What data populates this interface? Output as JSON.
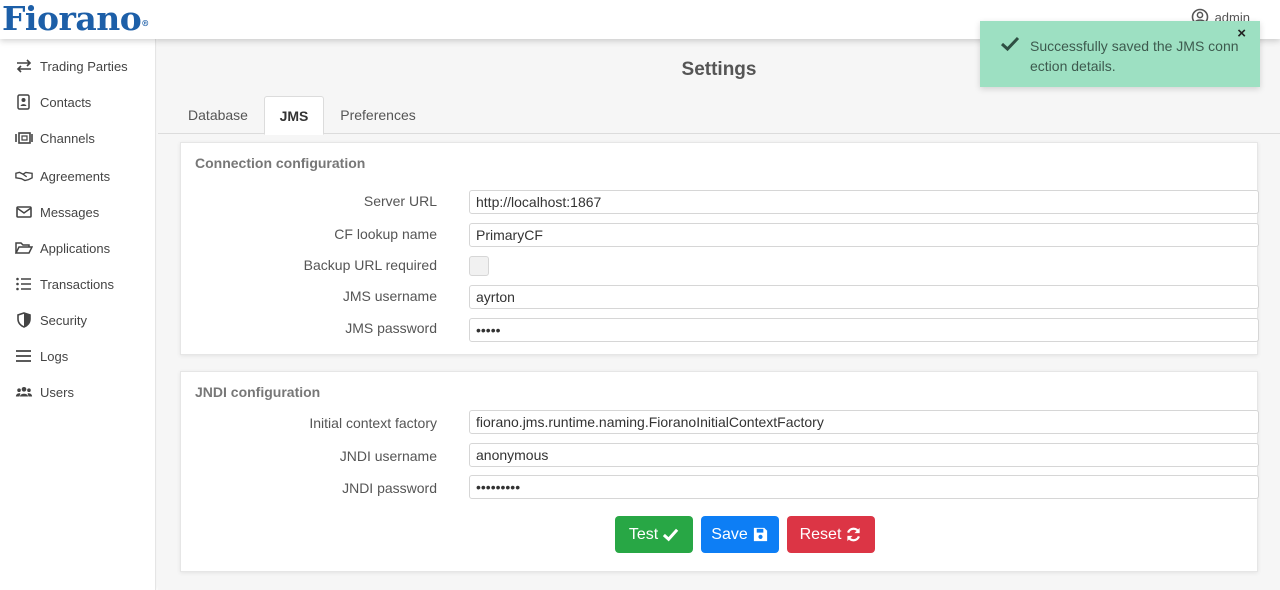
{
  "brand": {
    "logo_text": "Fiorano",
    "reg_mark": "®"
  },
  "header": {
    "username": "admin",
    "user_icon": "user-circle-icon"
  },
  "sidebar": {
    "items": [
      {
        "label": "Trading Parties",
        "icon": "arrows-exchange-icon"
      },
      {
        "label": "Contacts",
        "icon": "address-card-icon"
      },
      {
        "label": "Channels",
        "icon": "channel-icon"
      },
      {
        "label": "Agreements",
        "icon": "handshake-icon"
      },
      {
        "label": "Messages",
        "icon": "envelope-icon"
      },
      {
        "label": "Applications",
        "icon": "folder-open-icon"
      },
      {
        "label": "Transactions",
        "icon": "list-icon"
      },
      {
        "label": "Security",
        "icon": "shield-icon"
      },
      {
        "label": "Logs",
        "icon": "bars-icon"
      },
      {
        "label": "Users",
        "icon": "users-icon"
      }
    ]
  },
  "page": {
    "title": "Settings"
  },
  "tabs": [
    {
      "label": "Database",
      "active": false
    },
    {
      "label": "JMS",
      "active": true
    },
    {
      "label": "Preferences",
      "active": false
    }
  ],
  "connection": {
    "title": "Connection configuration",
    "server_url_label": "Server URL",
    "server_url_value": "http://localhost:1867",
    "cf_lookup_label": "CF lookup name",
    "cf_lookup_value": "PrimaryCF",
    "backup_url_label": "Backup URL required",
    "backup_url_checked": false,
    "jms_username_label": "JMS username",
    "jms_username_value": "ayrton",
    "jms_password_label": "JMS password",
    "jms_password_value": "•••••"
  },
  "jndi": {
    "title": "JNDI configuration",
    "icf_label": "Initial context factory",
    "icf_value": "fiorano.jms.runtime.naming.FioranoInitialContextFactory",
    "username_label": "JNDI username",
    "username_value": "anonymous",
    "password_label": "JNDI password",
    "password_value": "•••••••••"
  },
  "actions": {
    "test_label": "Test",
    "save_label": "Save",
    "reset_label": "Reset"
  },
  "toast": {
    "message": "Successfully saved the JMS connection details.",
    "close": "×"
  },
  "colors": {
    "brand": "#1d5fa8",
    "test": "#28a745",
    "save": "#0d7ef5",
    "reset": "#dc3545",
    "toast_bg": "#9de0c2"
  }
}
